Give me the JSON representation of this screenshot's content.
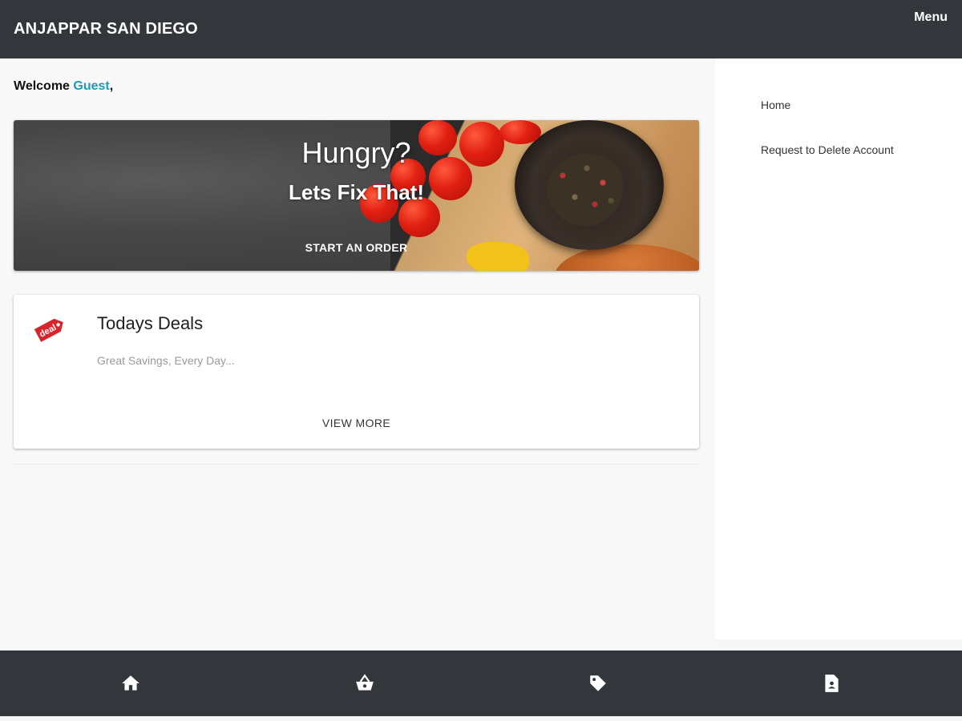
{
  "header": {
    "title": "ANJAPPAR SAN DIEGO",
    "menu_label": "Menu"
  },
  "welcome": {
    "prefix": "Welcome ",
    "user": "Guest",
    "suffix": ","
  },
  "hero": {
    "title": "Hungry?",
    "subtitle": "Lets Fix That!",
    "cta_label": "START AN ORDER"
  },
  "deals": {
    "title": "Todays Deals",
    "subtitle": "Great Savings, Every Day...",
    "view_more_label": "VIEW MORE",
    "icon": "deal-tag-icon",
    "icon_text": "deal"
  },
  "sidebar": {
    "items": [
      {
        "label": "Home"
      },
      {
        "label": "Request to Delete Account"
      }
    ]
  },
  "bottom_nav": {
    "items": [
      {
        "icon": "home-icon"
      },
      {
        "icon": "basket-icon"
      },
      {
        "icon": "tag-icon"
      },
      {
        "icon": "document-icon"
      }
    ]
  },
  "colors": {
    "bar": "#33363b",
    "accent_guest": "#1f9bb5",
    "deal_red": "#d9232d"
  }
}
